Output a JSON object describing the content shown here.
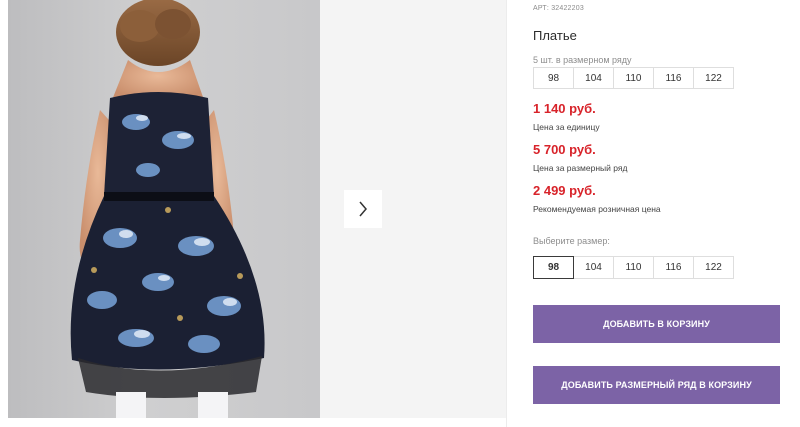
{
  "product": {
    "article": "АРТ: 32422203",
    "title": "Платье",
    "size_row_note": "5 шт. в размерном ряду",
    "size_row": [
      "98",
      "104",
      "110",
      "116",
      "122"
    ],
    "prices": [
      {
        "value": "1 140 руб.",
        "label": "Цена за единицу"
      },
      {
        "value": "5 700 руб.",
        "label": "Цена за размерный ряд"
      },
      {
        "value": "2 499 руб.",
        "label": "Рекомендуемая розничная цена"
      }
    ],
    "choose_size_label": "Выберите размер:",
    "size_options": [
      "98",
      "104",
      "110",
      "116",
      "122"
    ],
    "selected_size": "98"
  },
  "buttons": {
    "add_to_cart": "ДОБАВИТЬ В КОРЗИНУ",
    "add_size_row": "ДОБАВИТЬ РАЗМЕРНЫЙ РЯД В КОРЗИНУ"
  },
  "gallery": {
    "next_icon": "chevron-right-icon"
  },
  "colors": {
    "price": "#d8232a",
    "button": "#7c63a6"
  }
}
